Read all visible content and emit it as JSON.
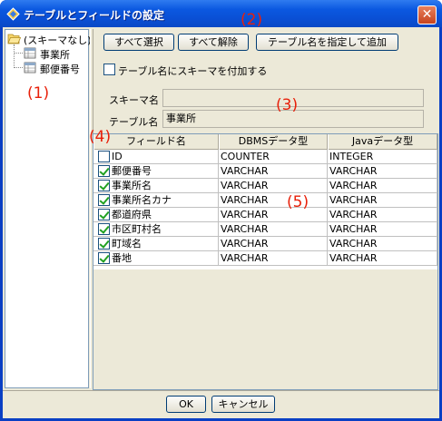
{
  "window": {
    "title": "テーブルとフィールドの設定"
  },
  "tree": {
    "root": "(スキーマなし)",
    "items": [
      "事業所",
      "郵便番号"
    ]
  },
  "toolbar": {
    "select_all": "すべて選択",
    "deselect_all": "すべて解除",
    "add_by_name": "テーブル名を指定して追加"
  },
  "options": {
    "add_schema_label": "テーブル名にスキーマを付加する",
    "add_schema_checked": false
  },
  "form": {
    "schema_label": "スキーマ名",
    "schema_value": "",
    "table_label": "テーブル名",
    "table_value": "事業所"
  },
  "table": {
    "headers": [
      "フィールド名",
      "DBMSデータ型",
      "Javaデータ型"
    ],
    "rows": [
      {
        "checked": false,
        "field": "ID",
        "dbms": "COUNTER",
        "java": "INTEGER"
      },
      {
        "checked": true,
        "field": "郵便番号",
        "dbms": "VARCHAR",
        "java": "VARCHAR"
      },
      {
        "checked": true,
        "field": "事業所名",
        "dbms": "VARCHAR",
        "java": "VARCHAR"
      },
      {
        "checked": true,
        "field": "事業所名カナ",
        "dbms": "VARCHAR",
        "java": "VARCHAR"
      },
      {
        "checked": true,
        "field": "都道府県",
        "dbms": "VARCHAR",
        "java": "VARCHAR"
      },
      {
        "checked": true,
        "field": "市区町村名",
        "dbms": "VARCHAR",
        "java": "VARCHAR"
      },
      {
        "checked": true,
        "field": "町域名",
        "dbms": "VARCHAR",
        "java": "VARCHAR"
      },
      {
        "checked": true,
        "field": "番地",
        "dbms": "VARCHAR",
        "java": "VARCHAR"
      }
    ]
  },
  "footer": {
    "ok": "OK",
    "cancel": "キャンセル"
  },
  "annotations": {
    "a1": "(1)",
    "a2": "(2)",
    "a3": "(3)",
    "a4": "(4)",
    "a5": "(5)",
    "color": "#e8200a"
  },
  "icons": {
    "title": "app-icon",
    "close": "close-icon",
    "folder": "folder-open-icon",
    "table": "table-icon"
  }
}
